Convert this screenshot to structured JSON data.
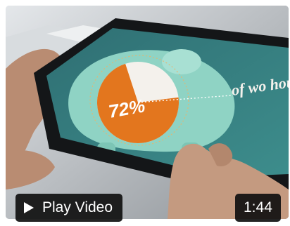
{
  "video": {
    "play_label": "Play Video",
    "duration": "1:44"
  },
  "screen_graphic": {
    "percent_label": "72%",
    "percent_value": 72,
    "tagline": "of wo hous",
    "colors": {
      "screen_bg": "#3f8a8a",
      "piggy": "#8fd3c4",
      "pie_orange": "#e3761e",
      "pie_rest": "#f4f1ec",
      "accent_orange": "#f08a2a"
    }
  },
  "icons": {
    "play": "play-icon"
  }
}
